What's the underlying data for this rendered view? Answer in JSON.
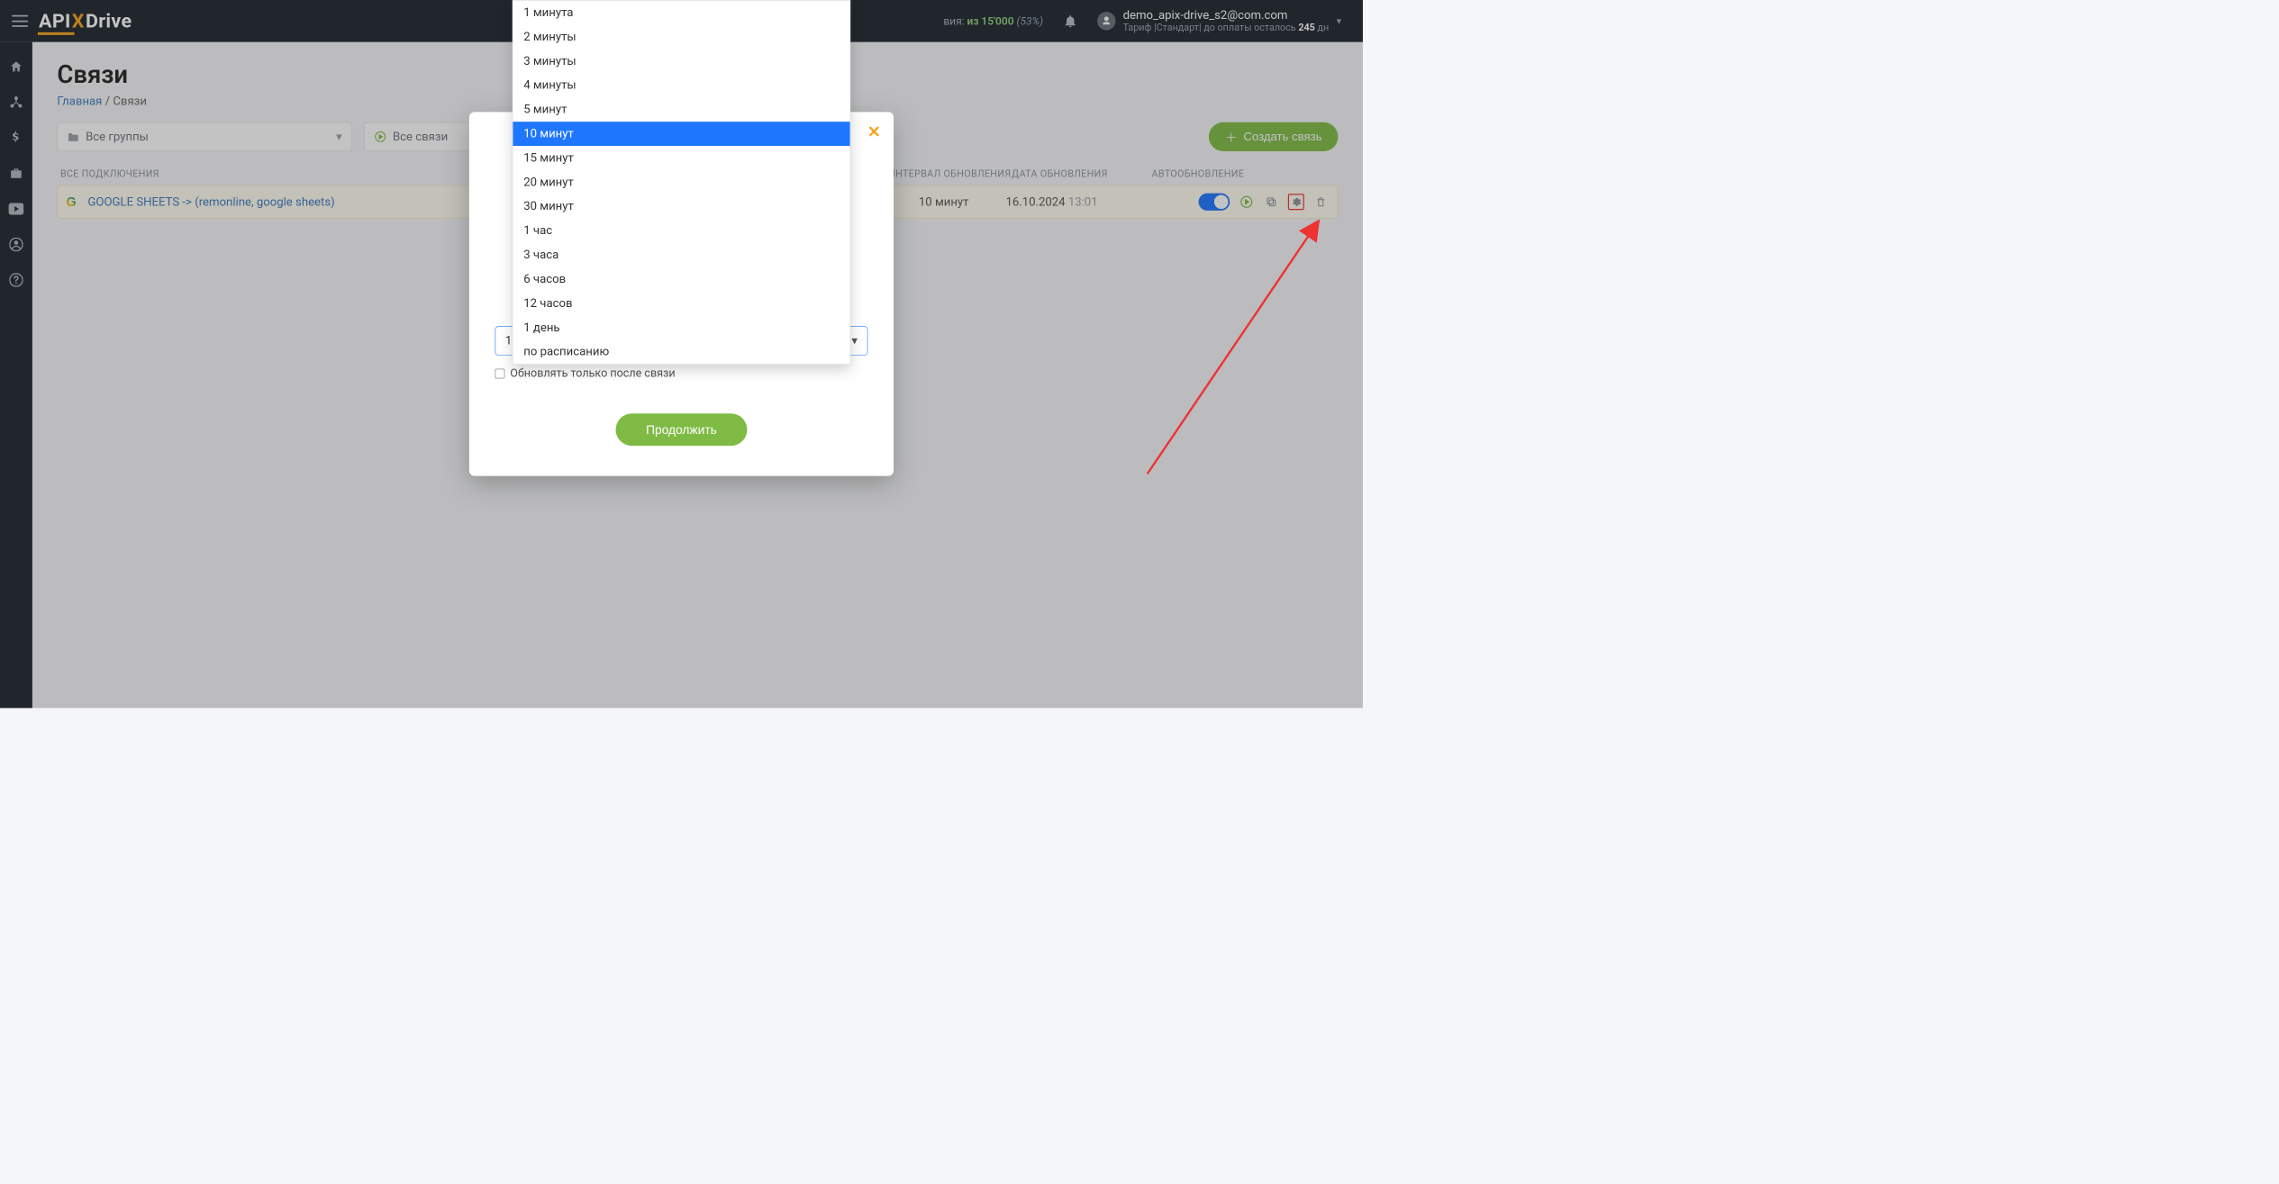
{
  "logo": {
    "api": "API",
    "x": "X",
    "drive": "Drive"
  },
  "usage": {
    "suffix_label": "вия:",
    "used_of": "из 15'000",
    "percent": "(53%)"
  },
  "user": {
    "email": "demo_apix-drive_s2@com.com",
    "tariff_prefix": "Тариф |Стандарт| до оплаты осталось ",
    "tariff_days": "245",
    "tariff_suffix": " дн"
  },
  "page": {
    "title": "Связи",
    "breadcrumb_home": "Главная",
    "breadcrumb_sep": " / ",
    "breadcrumb_current": "Связи"
  },
  "filters": {
    "groups_label": "Все группы",
    "links_label": "Все связи"
  },
  "create_button": "Создать связь",
  "columns": {
    "all": "ВСЕ ПОДКЛЮЧЕНИЯ",
    "interval": "ИНТЕРВАЛ ОБНОВЛЕНИЯ",
    "date": "ДАТА ОБНОВЛЕНИЯ",
    "auto": "АВТООБНОВЛЕНИЕ"
  },
  "rows": [
    {
      "name": "GOOGLE SHEETS -> (remonline, google sheets)",
      "interval": "10 минут",
      "date": "16.10.2024",
      "time": "13:01"
    }
  ],
  "modal": {
    "selected_value": "10 минут",
    "checkbox_label": "Обновлять только после связи",
    "continue": "Продолжить",
    "options": [
      "1 минута",
      "2 минуты",
      "3 минуты",
      "4 минуты",
      "5 минут",
      "10 минут",
      "15 минут",
      "20 минут",
      "30 минут",
      "1 час",
      "3 часа",
      "6 часов",
      "12 часов",
      "1 день",
      "по расписанию"
    ],
    "selected_index": 5
  }
}
